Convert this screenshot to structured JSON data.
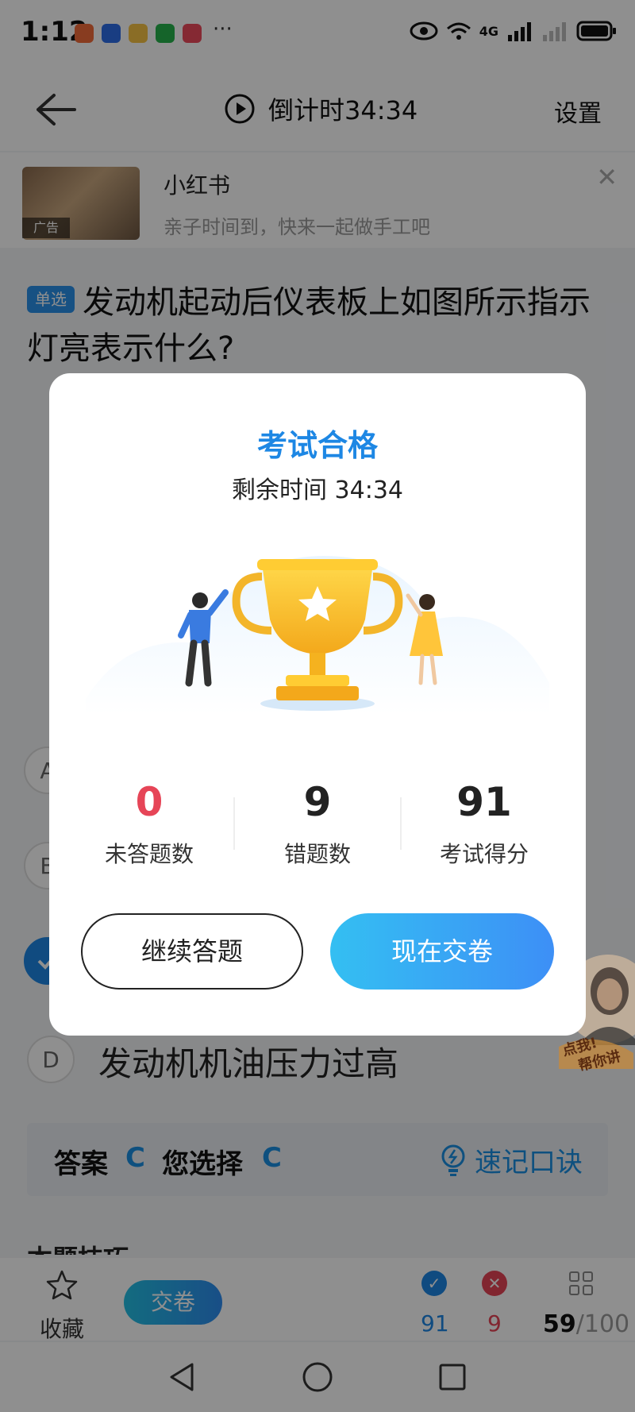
{
  "status_bar": {
    "time": "1:12",
    "more": "···",
    "network": "4G",
    "icons": [
      "eye-icon",
      "wifi-icon",
      "signal-icon",
      "battery-icon"
    ]
  },
  "nav": {
    "timer_label": "倒计时34:34",
    "settings_label": "设置"
  },
  "ad": {
    "title": "小红书",
    "subtitle": "亲子时间到，快来一起做手工吧",
    "tag": "广告"
  },
  "question": {
    "type_tag": "单选",
    "text": "发动机起动后仪表板上如图所示指示灯亮表示什么?"
  },
  "options": {
    "a_letter": "A",
    "b_letter": "B",
    "d_letter": "D",
    "d_text": "发动机机油压力过高"
  },
  "answer": {
    "answer_label": "答案",
    "answer_value": "C",
    "chosen_label": "您选择",
    "chosen_value": "C",
    "tip_label": "速记口诀"
  },
  "section_peek": "本题技巧",
  "bottom_bar": {
    "favorite_label": "收藏",
    "submit_label": "交卷",
    "correct_count": "91",
    "wrong_count": "9",
    "progress_current": "59",
    "progress_total": "/100"
  },
  "modal": {
    "title": "考试合格",
    "time_remaining": "剩余时间 34:34",
    "stats": [
      {
        "value": "0",
        "label": "未答题数"
      },
      {
        "value": "9",
        "label": "错题数"
      },
      {
        "value": "91",
        "label": "考试得分"
      }
    ],
    "continue_label": "继续答题",
    "submit_label": "现在交卷"
  },
  "promo": {
    "line1": "点我!",
    "line2": "帮你讲"
  },
  "colors": {
    "accent": "#1d87e4",
    "red": "#e64557",
    "overlay": "rgba(0,0,0,0.44)"
  }
}
